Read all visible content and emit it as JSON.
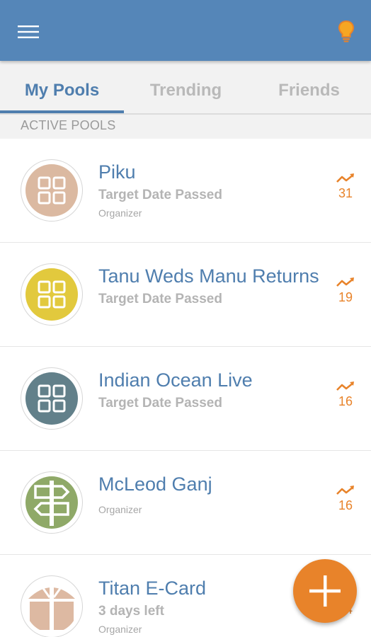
{
  "app_bar": {
    "menu_icon": "menu-icon",
    "bulb_icon": "lightbulb-icon",
    "color": "#5586b8",
    "accent": "#e8832a"
  },
  "tabs": [
    {
      "label": "My Pools",
      "active": true
    },
    {
      "label": "Trending",
      "active": false
    },
    {
      "label": "Friends",
      "active": false
    }
  ],
  "section_label": "ACTIVE POOLS",
  "pools": [
    {
      "title": "Piku",
      "status": "Target Date Passed",
      "role": "Organizer",
      "count": "31",
      "avatar_icon": "grid-icon",
      "avatar_color": "#dbb9a1"
    },
    {
      "title": "Tanu Weds Manu Returns",
      "status": "Target Date Passed",
      "role": "",
      "count": "19",
      "avatar_icon": "grid-icon",
      "avatar_color": "#e2c93d"
    },
    {
      "title": "Indian Ocean Live",
      "status": "Target Date Passed",
      "role": "",
      "count": "16",
      "avatar_icon": "grid-icon",
      "avatar_color": "#62808a"
    },
    {
      "title": "McLeod Ganj",
      "status": "",
      "role": "Organizer",
      "count": "16",
      "avatar_icon": "signpost-icon",
      "avatar_color": "#8fa968"
    },
    {
      "title": "Titan E-Card",
      "status": "3 days left",
      "role": "Organizer",
      "count": "14",
      "avatar_icon": "gift-icon",
      "avatar_color": "#ddb9a2"
    }
  ],
  "fab_icon": "plus-icon"
}
